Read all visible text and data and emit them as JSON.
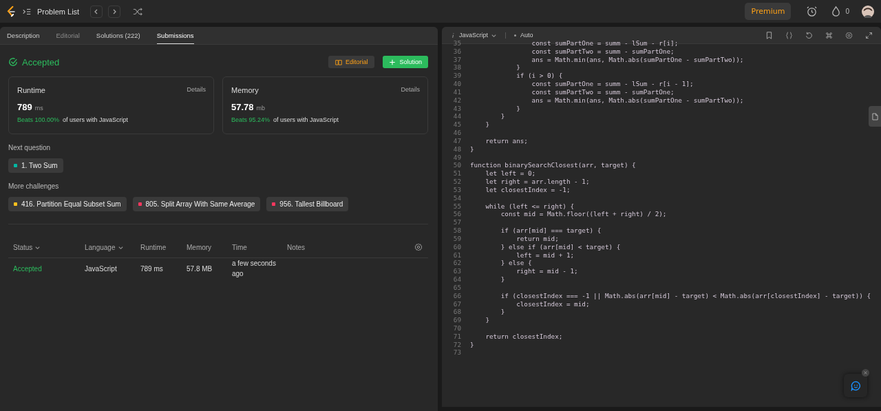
{
  "topbar": {
    "title": "Problem List",
    "premium": "Premium",
    "streak": "0"
  },
  "tabs": [
    {
      "label": "Description",
      "selected": false,
      "disabled": false
    },
    {
      "label": "Editorial",
      "selected": false,
      "disabled": true
    },
    {
      "label": "Solutions (222)",
      "selected": false,
      "disabled": false
    },
    {
      "label": "Submissions",
      "selected": true,
      "disabled": false
    }
  ],
  "result": {
    "status": "Accepted",
    "editorial_button": "Editorial",
    "solution_button": "Solution"
  },
  "stats": [
    {
      "label": "Runtime",
      "details": "Details",
      "value": "789",
      "unit": "ms",
      "beats": "Beats 100.00%",
      "suffix": "of users with JavaScript"
    },
    {
      "label": "Memory",
      "details": "Details",
      "value": "57.78",
      "unit": "mb",
      "beats": "Beats 95.24%",
      "suffix": "of users with JavaScript"
    }
  ],
  "next_question": {
    "heading": "Next question",
    "items": [
      {
        "label": "1. Two Sum",
        "color": "#00b8a3"
      }
    ]
  },
  "more_challenges": {
    "heading": "More challenges",
    "items": [
      {
        "label": "416. Partition Equal Subset Sum",
        "color": "#ffc01e"
      },
      {
        "label": "805. Split Array With Same Average",
        "color": "#ff375f"
      },
      {
        "label": "956. Tallest Billboard",
        "color": "#ff375f"
      }
    ]
  },
  "table": {
    "columns": [
      {
        "label": "Status",
        "sortable": true
      },
      {
        "label": "Language",
        "sortable": true
      },
      {
        "label": "Runtime",
        "sortable": false
      },
      {
        "label": "Memory",
        "sortable": false
      },
      {
        "label": "Time",
        "sortable": false
      },
      {
        "label": "Notes",
        "sortable": false
      }
    ],
    "rows": [
      {
        "status": "Accepted",
        "language": "JavaScript",
        "runtime": "789 ms",
        "memory": "57.8 MB",
        "time": "a few seconds ago"
      }
    ]
  },
  "editor": {
    "language": "JavaScript",
    "mode": "Auto",
    "lines": [
      {
        "num": "35",
        "text": "                const sumPartOne = summ - lSum - r[i];"
      },
      {
        "num": "36",
        "text": "                const sumPartTwo = summ - sumPartOne;"
      },
      {
        "num": "37",
        "text": "                ans = Math.min(ans, Math.abs(sumPartOne - sumPartTwo));"
      },
      {
        "num": "38",
        "text": "            }"
      },
      {
        "num": "39",
        "text": "            if (i > 0) {"
      },
      {
        "num": "40",
        "text": "                const sumPartOne = summ - lSum - r[i - 1];"
      },
      {
        "num": "41",
        "text": "                const sumPartTwo = summ - sumPartOne;"
      },
      {
        "num": "42",
        "text": "                ans = Math.min(ans, Math.abs(sumPartOne - sumPartTwo));"
      },
      {
        "num": "43",
        "text": "            }"
      },
      {
        "num": "44",
        "text": "        }"
      },
      {
        "num": "45",
        "text": "    }"
      },
      {
        "num": "46"
      },
      {
        "num": "47",
        "text": "    return ans;"
      },
      {
        "num": "48",
        "text": "}"
      },
      {
        "num": "49"
      },
      {
        "num": "50",
        "text": "function binarySearchClosest(arr, target) {"
      },
      {
        "num": "51",
        "text": "    let left = 0;"
      },
      {
        "num": "52",
        "text": "    let right = arr.length - 1;"
      },
      {
        "num": "53",
        "text": "    let closestIndex = -1;"
      },
      {
        "num": "54"
      },
      {
        "num": "55",
        "text": "    while (left <= right) {"
      },
      {
        "num": "56",
        "text": "        const mid = Math.floor((left + right) / 2);"
      },
      {
        "num": "57"
      },
      {
        "num": "58",
        "text": "        if (arr[mid] === target) {"
      },
      {
        "num": "59",
        "text": "            return mid;"
      },
      {
        "num": "60",
        "text": "        } else if (arr[mid] < target) {"
      },
      {
        "num": "61",
        "text": "            left = mid + 1;"
      },
      {
        "num": "62",
        "text": "        } else {"
      },
      {
        "num": "63",
        "text": "            right = mid - 1;"
      },
      {
        "num": "64",
        "text": "        }"
      },
      {
        "num": "65"
      },
      {
        "num": "66",
        "text": "        if (closestIndex === -1 || Math.abs(arr[mid] - target) < Math.abs(arr[closestIndex] - target)) {"
      },
      {
        "num": "67",
        "text": "            closestIndex = mid;"
      },
      {
        "num": "68",
        "text": "        }"
      },
      {
        "num": "69",
        "text": "    }"
      },
      {
        "num": "70"
      },
      {
        "num": "71",
        "text": "    return closestIndex;"
      },
      {
        "num": "72",
        "text": "}"
      },
      {
        "num": "73"
      }
    ]
  }
}
